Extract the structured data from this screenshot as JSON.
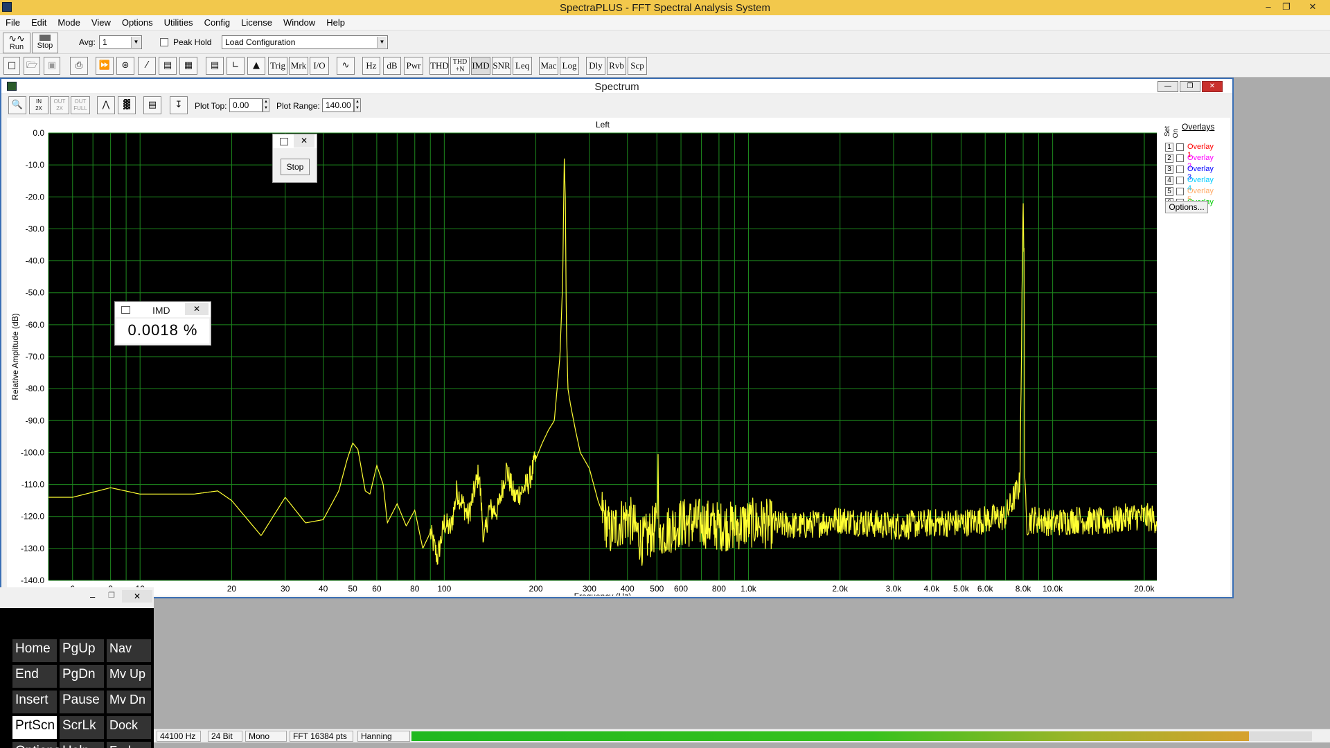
{
  "app": {
    "title": "SpectraPLUS - FFT Spectral Analysis System"
  },
  "menu": [
    "File",
    "Edit",
    "Mode",
    "View",
    "Options",
    "Utilities",
    "Config",
    "License",
    "Window",
    "Help"
  ],
  "toolbar1": {
    "run_label": "Run",
    "stop_label": "Stop",
    "avg_label": "Avg:",
    "avg_value": "1",
    "peak_hold_label": "Peak Hold",
    "config_value": "Load Configuration"
  },
  "toolbar2": {
    "buttons": [
      "Trig",
      "Mrk",
      "I/O",
      "Hz",
      "dB",
      "Pwr",
      "THD",
      "THD\n+N",
      "IMD",
      "SNR",
      "Leq",
      "Mac",
      "Log",
      "Dly",
      "Rvb",
      "Scp"
    ]
  },
  "spectrum": {
    "window_title": "Spectrum",
    "plot_top_label": "Plot Top:",
    "plot_top_value": "0.00",
    "plot_range_label": "Plot Range:",
    "plot_range_value": "140.00",
    "channel_label": "Left",
    "zoom_labels": [
      "IN\n2X",
      "OUT\n2X",
      "OUT\nFULL"
    ]
  },
  "overlays": {
    "title": "Overlays",
    "col_set": "Set",
    "col_on": "On",
    "items": [
      {
        "num": "1",
        "label": "Overlay 1",
        "color": "#ff0000"
      },
      {
        "num": "2",
        "label": "Overlay 2",
        "color": "#ff00ff"
      },
      {
        "num": "3",
        "label": "Overlay 3",
        "color": "#0000ff"
      },
      {
        "num": "4",
        "label": "Overlay 4",
        "color": "#00ccff"
      },
      {
        "num": "5",
        "label": "Overlay 5",
        "color": "#ffaa66"
      },
      {
        "num": "6",
        "label": "Overlay 6",
        "color": "#00cc00"
      }
    ],
    "options_label": "Options..."
  },
  "popup_stop": {
    "button_label": "Stop"
  },
  "imd_popup": {
    "title": "IMD",
    "value": "0.0018 %"
  },
  "keyboard": {
    "keys": [
      [
        "Home",
        "PgUp",
        "Nav"
      ],
      [
        "End",
        "PgDn",
        "Mv Up"
      ],
      [
        "Insert",
        "Pause",
        "Mv Dn"
      ],
      [
        "PrtScn",
        "ScrLk",
        "Dock"
      ],
      [
        "Options",
        "Help",
        "Fade"
      ]
    ],
    "selected": "PrtScn"
  },
  "status": {
    "sample_rate": "44100 Hz",
    "bits": "24 Bit",
    "channels": "Mono",
    "fft": "FFT 16384 pts",
    "window": "Hanning",
    "level_fraction": 0.93
  },
  "chart_data": {
    "type": "line",
    "title": "Left",
    "xlabel": "Frequency (Hz)",
    "ylabel": "Relative Amplitude (dB)",
    "xscale": "log",
    "xlim": [
      5,
      22000
    ],
    "ylim": [
      -140,
      0
    ],
    "grid": true,
    "background": "#000000",
    "grid_color": "#1e8a1e",
    "line_color": "#ffff33",
    "y_ticks": [
      "0.0",
      "-10.0",
      "-20.0",
      "-30.0",
      "-40.0",
      "-50.0",
      "-60.0",
      "-70.0",
      "-80.0",
      "-90.0",
      "-100.0",
      "-110.0",
      "-120.0",
      "-130.0",
      "-140.0"
    ],
    "x_ticks": [
      {
        "v": 6,
        "label": "6"
      },
      {
        "v": 8,
        "label": "8"
      },
      {
        "v": 10,
        "label": "10"
      },
      {
        "v": 20,
        "label": "20"
      },
      {
        "v": 30,
        "label": "30"
      },
      {
        "v": 40,
        "label": "40"
      },
      {
        "v": 50,
        "label": "50"
      },
      {
        "v": 60,
        "label": "60"
      },
      {
        "v": 80,
        "label": "80"
      },
      {
        "v": 100,
        "label": "100"
      },
      {
        "v": 200,
        "label": "200"
      },
      {
        "v": 300,
        "label": "300"
      },
      {
        "v": 400,
        "label": "400"
      },
      {
        "v": 500,
        "label": "500"
      },
      {
        "v": 600,
        "label": "600"
      },
      {
        "v": 800,
        "label": "800"
      },
      {
        "v": 1000,
        "label": "1.0k"
      },
      {
        "v": 2000,
        "label": "2.0k"
      },
      {
        "v": 3000,
        "label": "3.0k"
      },
      {
        "v": 4000,
        "label": "4.0k"
      },
      {
        "v": 5000,
        "label": "5.0k"
      },
      {
        "v": 6000,
        "label": "6.0k"
      },
      {
        "v": 8000,
        "label": "8.0k"
      },
      {
        "v": 10000,
        "label": "10.0k"
      },
      {
        "v": 20000,
        "label": "20.0k"
      }
    ],
    "series": [
      {
        "x": [
          5,
          6,
          8,
          10,
          12,
          15,
          18,
          20,
          25,
          30,
          35,
          40,
          45,
          48,
          50,
          52,
          55,
          57,
          60,
          63,
          65,
          70,
          75,
          80,
          85,
          90,
          95,
          100,
          105,
          110,
          120,
          130,
          135,
          140,
          150,
          160,
          170,
          180,
          190,
          200,
          210,
          220,
          230,
          240,
          245,
          248,
          250,
          252,
          255,
          260,
          270,
          280,
          300,
          320,
          350,
          400,
          450,
          500,
          505,
          510,
          520,
          600,
          700,
          800,
          900,
          1000,
          1500,
          2000,
          3000,
          4000,
          5000,
          6000,
          7000,
          7800,
          8000,
          8050,
          8100,
          8200,
          8500,
          9000,
          10000,
          12000,
          15000,
          18000,
          20000,
          22000
        ],
        "y": [
          -114,
          -114,
          -111,
          -113,
          -113,
          -113,
          -112,
          -115,
          -126,
          -114,
          -122,
          -121,
          -112,
          -102,
          -97,
          -99,
          -112,
          -113,
          -104,
          -110,
          -122,
          -116,
          -123,
          -118,
          -130,
          -125,
          -133,
          -122,
          -124,
          -112,
          -120,
          -106,
          -128,
          -118,
          -118,
          -105,
          -114,
          -112,
          -109,
          -102,
          -97,
          -93,
          -90,
          -70,
          -47,
          -8,
          -20,
          -60,
          -80,
          -85,
          -93,
          -100,
          -105,
          -115,
          -125,
          -120,
          -128,
          -123,
          -102,
          -130,
          -125,
          -122,
          -122,
          -123,
          -123,
          -122,
          -123,
          -121,
          -123,
          -122,
          -122,
          -121,
          -120,
          -110,
          -22,
          -36,
          -112,
          -122,
          -121,
          -121,
          -122,
          -121,
          -122,
          -120,
          -120,
          -121
        ]
      }
    ]
  }
}
